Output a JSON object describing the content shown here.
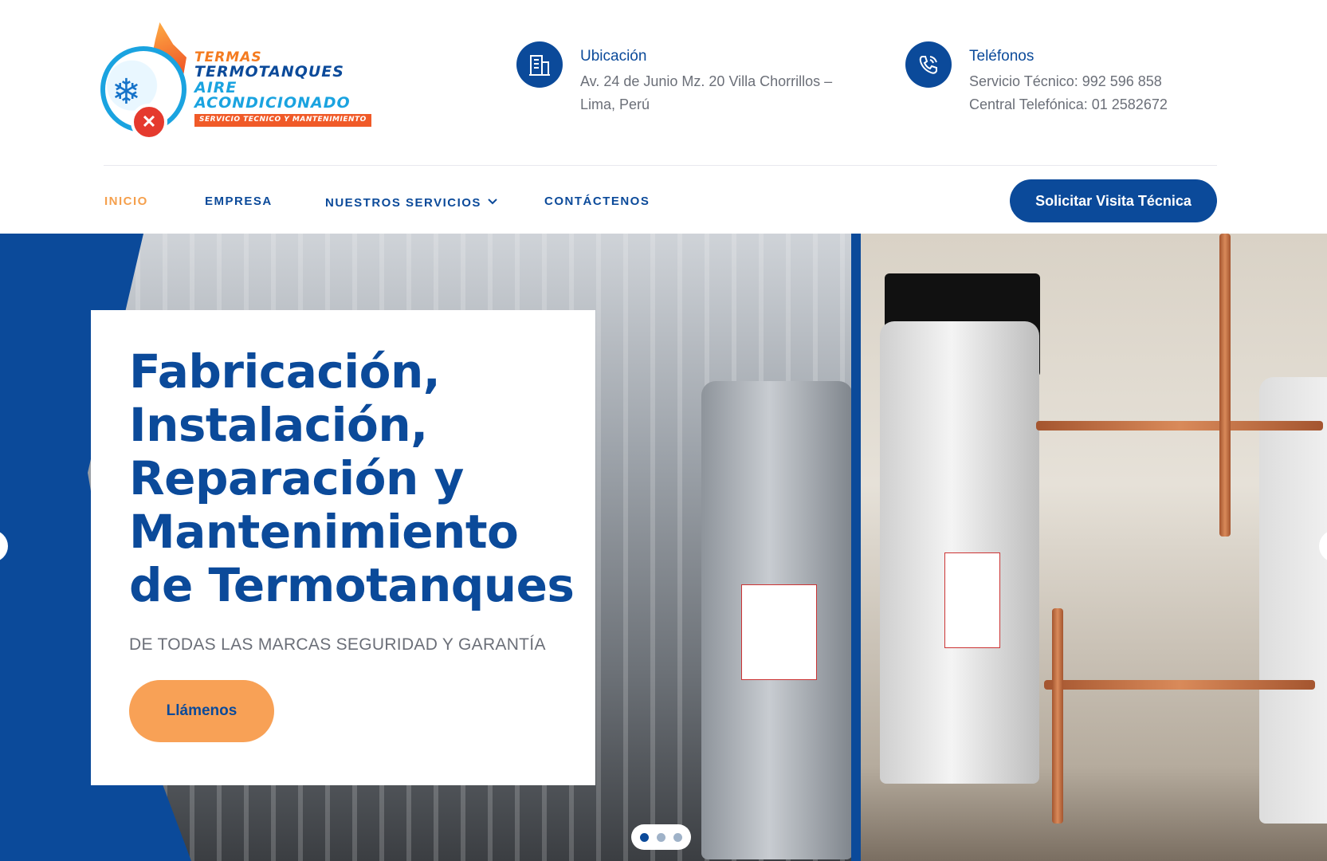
{
  "logo": {
    "line1": "TERMAS",
    "line2": "TERMOTANQUES",
    "line3": "AIRE ACONDICIONADO",
    "line4": "SERVICIO TECNICO Y MANTENIMIENTO"
  },
  "location": {
    "icon": "building-icon",
    "title": "Ubicación",
    "line1": "Av. 24 de Junio Mz. 20 Villa Chorrillos –",
    "line2": "Lima, Perú"
  },
  "phones": {
    "icon": "phone-icon",
    "title": "Teléfonos",
    "line1": "Servicio Técnico: 992 596 858",
    "line2": "Central Telefónica: 01 2582672"
  },
  "nav": {
    "items": [
      "INICIO",
      "EMPRESA",
      "NUESTROS SERVICIOS",
      "CONTÁCTENOS"
    ],
    "active": "INICIO",
    "cta": "Solicitar Visita Técnica"
  },
  "hero": {
    "title": "Fabricación, Instalación, Reparación y Mantenimiento de Termotanques",
    "subtitle": "DE TODAS LAS MARCAS SEGURIDAD Y GARANTÍA",
    "button": "Llámenos",
    "slides": 3,
    "active_slide": 1
  },
  "colors": {
    "brand_blue": "#0b4a9a",
    "accent_orange": "#f8a156",
    "nav_active": "#f5a04d",
    "text_gray": "#6b6f78"
  }
}
